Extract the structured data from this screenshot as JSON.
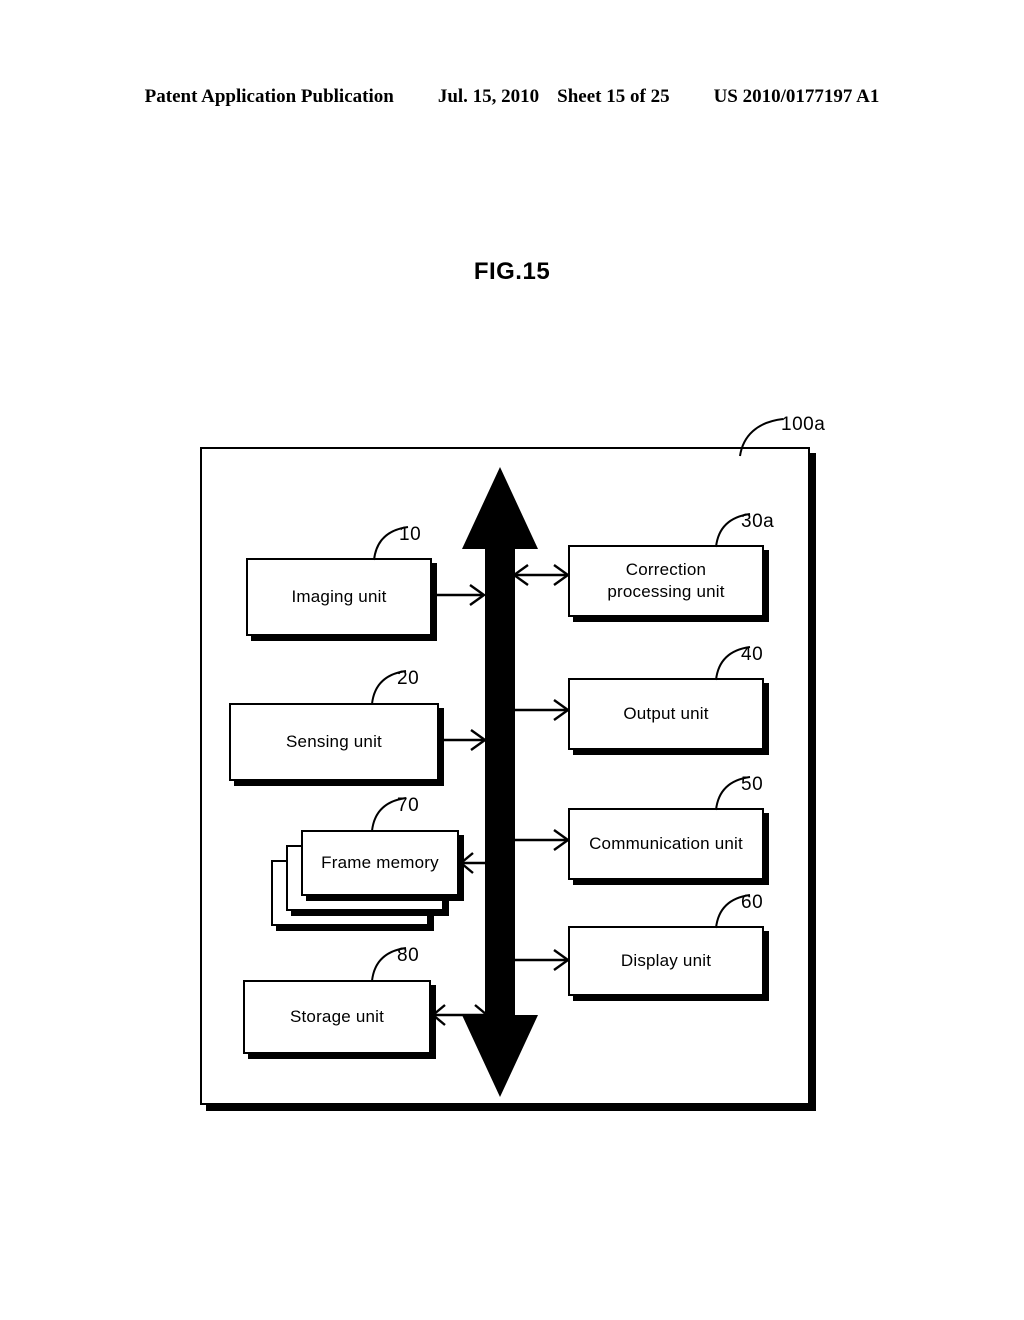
{
  "header": {
    "publication": "Patent Application Publication",
    "date": "Jul. 15, 2010",
    "sheet": "Sheet 15 of 25",
    "docnum": "US 2010/0177197 A1"
  },
  "figure": {
    "title": "FIG.15",
    "system_ref": "100a"
  },
  "diagram": {
    "type": "block-diagram",
    "bus": {
      "name": "system-bus",
      "style": "vertical double-headed thick arrow",
      "color": "#000000"
    },
    "left_blocks": [
      {
        "label": "Imaging unit",
        "ref": "10",
        "connection": "to-bus",
        "arrow": "single"
      },
      {
        "label": "Sensing unit",
        "ref": "20",
        "connection": "to-bus",
        "arrow": "single"
      },
      {
        "label": "Frame memory",
        "ref": "70",
        "connection": "bidirectional",
        "arrow": "double",
        "stacked": true
      },
      {
        "label": "Storage unit",
        "ref": "80",
        "connection": "bidirectional",
        "arrow": "double"
      }
    ],
    "right_blocks": [
      {
        "label": "Correction\nprocessing unit",
        "line1": "Correction",
        "line2": "processing unit",
        "ref": "30a",
        "connection": "bidirectional",
        "arrow": "double"
      },
      {
        "label": "Output unit",
        "ref": "40",
        "connection": "from-bus",
        "arrow": "single"
      },
      {
        "label": "Communication unit",
        "ref": "50",
        "connection": "from-bus",
        "arrow": "single"
      },
      {
        "label": "Display unit",
        "ref": "60",
        "connection": "from-bus",
        "arrow": "single"
      }
    ]
  },
  "colors": {
    "ink": "#000000",
    "paper": "#ffffff"
  }
}
